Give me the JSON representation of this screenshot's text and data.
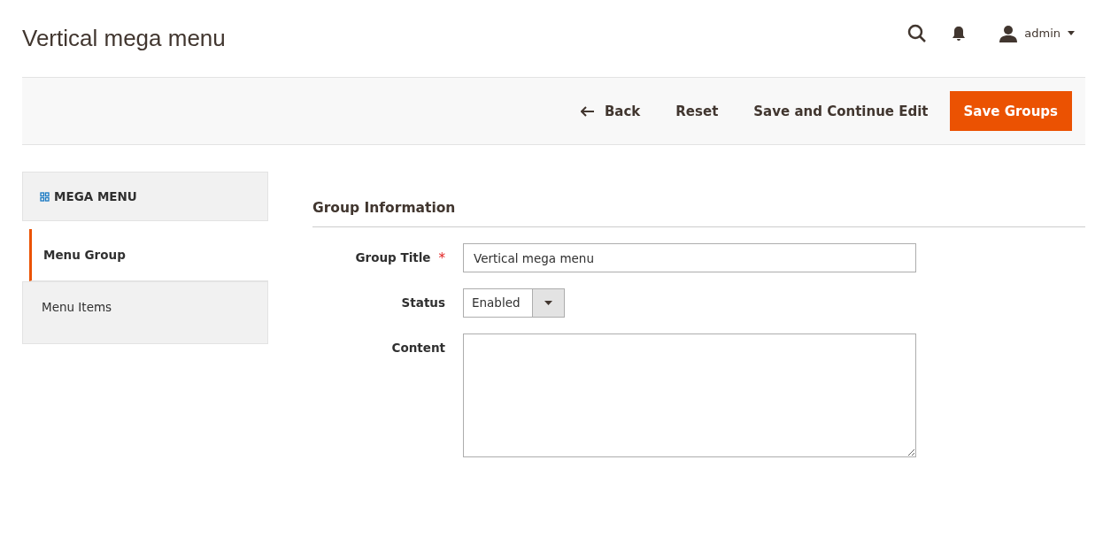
{
  "page_title": "Vertical mega menu",
  "header": {
    "user": "admin"
  },
  "actions": [
    {
      "kind": "back",
      "label": "Back"
    },
    {
      "kind": "plain",
      "label": "Reset"
    },
    {
      "kind": "plain",
      "label": "Save and Continue Edit"
    },
    {
      "kind": "primary",
      "label": "Save Groups"
    }
  ],
  "sidebar": {
    "title": "MEGA MENU",
    "items": [
      {
        "label": "Menu Group",
        "selected": true
      },
      {
        "label": "Menu Items",
        "selected": false
      }
    ]
  },
  "section": {
    "title": "Group Information",
    "fields": [
      {
        "kind": "text",
        "label": "Group Title",
        "required_mark": "*",
        "value": "Vertical mega menu"
      },
      {
        "kind": "select",
        "label": "Status",
        "value": "Enabled"
      },
      {
        "kind": "textarea",
        "label": "Content"
      }
    ]
  }
}
